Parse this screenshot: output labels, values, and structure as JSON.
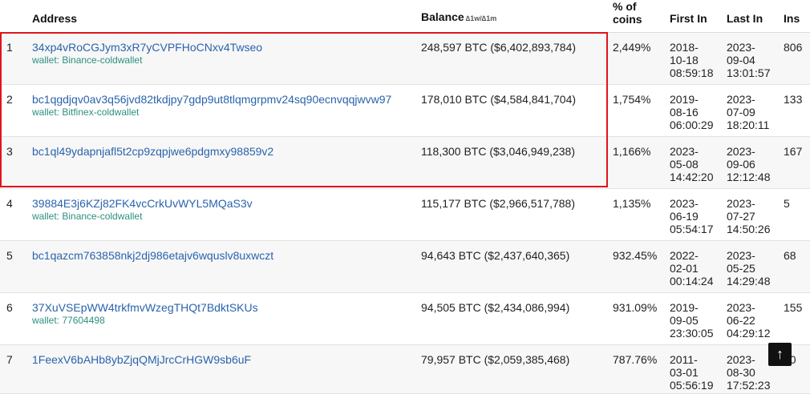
{
  "headers": {
    "address": "Address",
    "balance": "Balance",
    "balance_delta": "∆1w/∆1m",
    "pct_line1": "% of",
    "pct_line2": "coins",
    "first_in": "First In",
    "last_in": "Last In",
    "ins": "Ins"
  },
  "rows": [
    {
      "rank": "1",
      "address": "34xp4vRoCGJym3xR7yCVPFHoCNxv4Twseo",
      "wallet": "wallet: Binance-coldwallet",
      "balance": "248,597 BTC ($6,402,893,784)",
      "pct": "2,449%",
      "first": [
        "2018-",
        "10-18",
        "08:59:18"
      ],
      "last": [
        "2023-",
        "09-04",
        "13:01:57"
      ],
      "ins": "806"
    },
    {
      "rank": "2",
      "address": "bc1qgdjqv0av3q56jvd82tkdjpy7gdp9ut8tlqmgrpmv24sq90ecnvqqjwvw97",
      "wallet": "wallet: Bitfinex-coldwallet",
      "balance": "178,010 BTC ($4,584,841,704)",
      "pct": "1,754%",
      "first": [
        "2019-",
        "08-16",
        "06:00:29"
      ],
      "last": [
        "2023-",
        "07-09",
        "18:20:11"
      ],
      "ins": "133"
    },
    {
      "rank": "3",
      "address": "bc1ql49ydapnjafl5t2cp9zqpjwe6pdgmxy98859v2",
      "wallet": "",
      "balance": "118,300 BTC ($3,046,949,238)",
      "pct": "1,166%",
      "first": [
        "2023-",
        "05-08",
        "14:42:20"
      ],
      "last": [
        "2023-",
        "09-06",
        "12:12:48"
      ],
      "ins": "167"
    },
    {
      "rank": "4",
      "address": "39884E3j6KZj82FK4vcCrkUvWYL5MQaS3v",
      "wallet": "wallet: Binance-coldwallet",
      "balance": "115,177 BTC ($2,966,517,788)",
      "pct": "1,135%",
      "first": [
        "2023-",
        "06-19",
        "05:54:17"
      ],
      "last": [
        "2023-",
        "07-27",
        "14:50:26"
      ],
      "ins": "5"
    },
    {
      "rank": "5",
      "address": "bc1qazcm763858nkj2dj986etajv6wquslv8uxwczt",
      "wallet": "",
      "balance": "94,643 BTC ($2,437,640,365)",
      "pct": "932.45%",
      "first": [
        "2022-",
        "02-01",
        "00:14:24"
      ],
      "last": [
        "2023-",
        "05-25",
        "14:29:48"
      ],
      "ins": "68"
    },
    {
      "rank": "6",
      "address": "37XuVSEpWW4trkfmvWzegTHQt7BdktSKUs",
      "wallet": "wallet: 77604498",
      "balance": "94,505 BTC ($2,434,086,994)",
      "pct": "931.09%",
      "first": [
        "2019-",
        "09-05",
        "23:30:05"
      ],
      "last": [
        "2023-",
        "06-22",
        "04:29:12"
      ],
      "ins": "155"
    },
    {
      "rank": "7",
      "address": "1FeexV6bAHb8ybZjqQMjJrcCrHGW9sb6uF",
      "wallet": "",
      "balance": "79,957 BTC ($2,059,385,468)",
      "pct": "787.76%",
      "first": [
        "2011-",
        "03-01",
        "05:56:19"
      ],
      "last": [
        "2023-",
        "08-30",
        "17:52:23"
      ],
      "ins": "20"
    }
  ],
  "scroll_top_icon": "arrow-up-icon",
  "scroll_top_glyph": "↑",
  "highlight_color": "#e0151b",
  "link_color": "#2a63ad",
  "wallet_color": "#2d8f7f"
}
